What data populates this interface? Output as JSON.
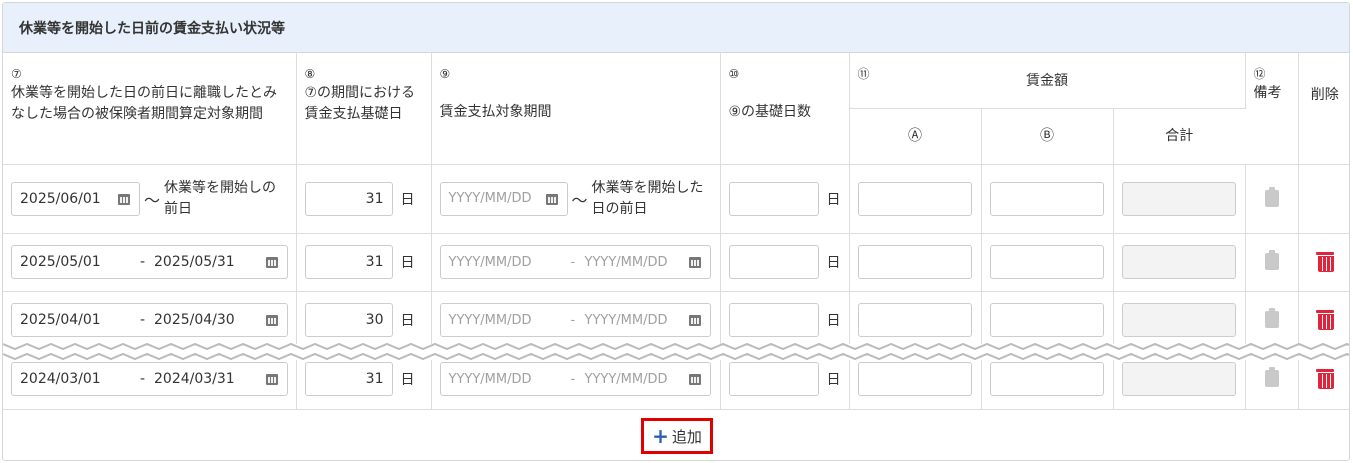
{
  "panel": {
    "title": "休業等を開始した日前の賃金支払い状況等"
  },
  "headers": {
    "col7": {
      "num": "⑦",
      "label": "休業等を開始した日の前日に離職したとみなした場合の被保険者期間算定対象期間"
    },
    "col8": {
      "num": "⑧",
      "label": "⑦の期間における賃金支払基礎日"
    },
    "col9": {
      "num": "⑨",
      "label": "賃金支払対象期間"
    },
    "col10": {
      "num": "⑩",
      "label": "⑨の基礎日数"
    },
    "col11": {
      "num": "⑪",
      "label": "賃金額",
      "sub_a": "Ⓐ",
      "sub_b": "Ⓑ",
      "sub_total": "合計"
    },
    "col12": {
      "num": "⑫",
      "label": "備考"
    },
    "delete": "削除"
  },
  "first_row": {
    "start": "2025/06/01",
    "tilde": "〜",
    "end_text": "休業等を開始しの前日",
    "days": "31",
    "unit": "日",
    "pay_start_placeholder": "YYYY/MM/DD",
    "pay_end_text": "休業等を開始した日の前日",
    "basis_days": "",
    "basis_unit": "日"
  },
  "rows": [
    {
      "start": "2025/05/01",
      "sep": "-",
      "end": "2025/05/31",
      "days": "31",
      "unit": "日",
      "pay_start_placeholder": "YYYY/MM/DD",
      "pay_sep": "-",
      "pay_end_placeholder": "YYYY/MM/DD",
      "basis_unit": "日"
    },
    {
      "start": "2025/04/01",
      "sep": "-",
      "end": "2025/04/30",
      "days": "30",
      "unit": "日",
      "pay_start_placeholder": "YYYY/MM/DD",
      "pay_sep": "-",
      "pay_end_placeholder": "YYYY/MM/DD",
      "basis_unit": "日"
    },
    {
      "start": "2024/03/01",
      "sep": "-",
      "end": "2024/03/31",
      "days": "31",
      "unit": "日",
      "pay_start_placeholder": "YYYY/MM/DD",
      "pay_sep": "-",
      "pay_end_placeholder": "YYYY/MM/DD",
      "basis_unit": "日"
    }
  ],
  "footer": {
    "add_icon": "plus-icon",
    "add_label": "追加"
  },
  "colors": {
    "header_bg": "#e8f1fb",
    "delete": "#e0243b",
    "add_plus": "#2b5fb4",
    "highlight": "#e00000"
  }
}
